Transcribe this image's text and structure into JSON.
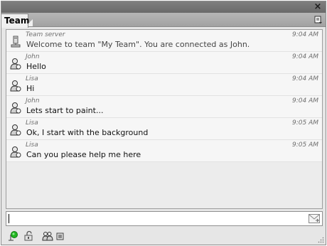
{
  "tab": {
    "label": "Team"
  },
  "messages": [
    {
      "sender": "Team server",
      "time": "9:04 AM",
      "text": "Welcome to team \"My Team\". You are connected as John.",
      "kind": "system"
    },
    {
      "sender": "John",
      "time": "9:04 AM",
      "text": "Hello",
      "kind": "user"
    },
    {
      "sender": "Lisa",
      "time": "9:04 AM",
      "text": "Hi",
      "kind": "user"
    },
    {
      "sender": "John",
      "time": "9:04 AM",
      "text": "Lets start to paint...",
      "kind": "user"
    },
    {
      "sender": "Lisa",
      "time": "9:05 AM",
      "text": "Ok, I start with the background",
      "kind": "user"
    },
    {
      "sender": "Lisa",
      "time": "9:05 AM",
      "text": "Can you please help me here",
      "kind": "user"
    }
  ],
  "input": {
    "value": ""
  },
  "icons": {
    "status": "connected-status-icon",
    "lock": "lock-icon",
    "users": "team-users-icon",
    "settings": "small-settings-icon",
    "send": "send-message-icon"
  },
  "colors": {
    "status_green": "#22b622",
    "panel_bg": "#e6e6e6"
  }
}
